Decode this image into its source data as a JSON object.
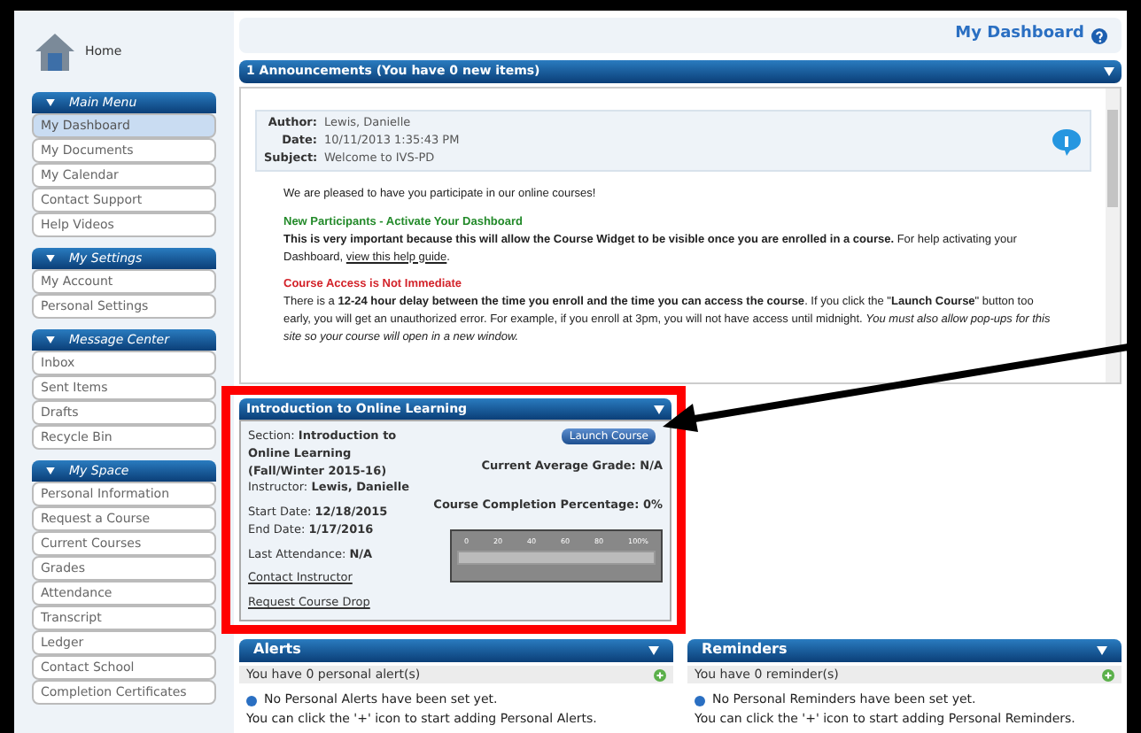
{
  "home": {
    "label": "Home"
  },
  "sidebar": [
    {
      "title": "Main Menu",
      "items": [
        {
          "label": "My Dashboard",
          "selected": true
        },
        {
          "label": "My Documents",
          "selected": false
        },
        {
          "label": "My Calendar",
          "selected": false
        },
        {
          "label": "Contact Support",
          "selected": false
        },
        {
          "label": "Help Videos",
          "selected": false
        }
      ]
    },
    {
      "title": "My Settings",
      "items": [
        {
          "label": "My Account",
          "selected": false
        },
        {
          "label": "Personal Settings",
          "selected": false
        }
      ]
    },
    {
      "title": "Message Center",
      "items": [
        {
          "label": "Inbox",
          "selected": false
        },
        {
          "label": "Sent Items",
          "selected": false
        },
        {
          "label": "Drafts",
          "selected": false
        },
        {
          "label": "Recycle Bin",
          "selected": false
        }
      ]
    },
    {
      "title": "My Space",
      "items": [
        {
          "label": "Personal Information",
          "selected": false
        },
        {
          "label": "Request a Course",
          "selected": false
        },
        {
          "label": "Current Courses",
          "selected": false
        },
        {
          "label": "Grades",
          "selected": false
        },
        {
          "label": "Attendance",
          "selected": false
        },
        {
          "label": "Transcript",
          "selected": false
        },
        {
          "label": "Ledger",
          "selected": false
        },
        {
          "label": "Contact School",
          "selected": false
        },
        {
          "label": "Completion Certificates",
          "selected": false
        }
      ]
    }
  ],
  "page_title": "My Dashboard",
  "announcements": {
    "header": "1 Announcements (You have 0 new items)",
    "meta": [
      {
        "label": "Author:",
        "value": "Lewis, Danielle"
      },
      {
        "label": "Date:",
        "value": "10/11/2013 1:35:43 PM"
      },
      {
        "label": "Subject:",
        "value": "Welcome to IVS-PD"
      }
    ],
    "intro": "We are pleased to have you participate in our online courses!",
    "sections": [
      {
        "kind": "green",
        "heading": "New Participants -  Activate Your Dashboard",
        "body": "**This is very important because this will allow the Course Widget to be visible once you are enrolled in a course.** For help activating your Dashboard,",
        "link": "view this help guide",
        "after_link": "."
      },
      {
        "kind": "red",
        "heading": "Course Access is Not Immediate",
        "body": "There is a **12-24 hour delay between the time you enroll and the time you can access the course**. If you click the \"**Launch Course**\" button too early, you will get an unauthorized error. For example, if you enroll at 3pm, you will not have access until midnight. *You must also allow pop-ups for this site so your course will open in a new window.*"
      }
    ]
  },
  "course": {
    "header": "Introduction to Online Learning",
    "section_label": "Section:",
    "section": "Introduction to Online Learning (Fall/Winter 2015-16)",
    "instructor_label": "Instructor:",
    "instructor": "Lewis, Danielle",
    "start_label": "Start Date:",
    "start": "12/18/2015",
    "end_label": "End Date:",
    "end": "1/17/2016",
    "attendance_label": "Last Attendance:",
    "attendance": "N/A",
    "links": [
      "Contact Instructor",
      "Request Course Drop"
    ],
    "launch": "Launch Course",
    "grade": "Current Average Grade: N/A",
    "completion": "Course Completion Percentage: 0%",
    "gauge": {
      "level": 0,
      "ticks": [
        "0",
        "20",
        "40",
        "60",
        "80",
        "100%"
      ]
    }
  },
  "alerts": {
    "header": "Alerts",
    "count": "You have 0 personal alert(s)",
    "info": "No Personal Alerts have been set yet.",
    "hint": "You can click the '+' icon to start adding Personal Alerts."
  },
  "reminders": {
    "header": "Reminders",
    "count": "You have 0 reminder(s)",
    "info": "No Personal Reminders have been set yet.",
    "hint": "You can click the '+' icon to start adding Personal Reminders."
  }
}
